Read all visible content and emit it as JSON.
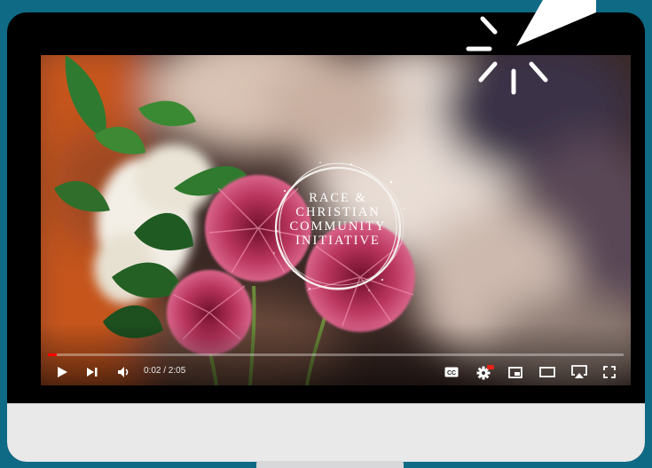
{
  "video": {
    "title_line1": "RACE &",
    "title_line2": "CHRISTIAN",
    "title_line3": "COMMUNITY",
    "title_line4": "INITIATIVE",
    "current_time": "0:02",
    "duration": "2:05",
    "time_display": "0:02 / 2:05",
    "progress_fraction": 0.016
  },
  "controls": {
    "play_icon": "play-icon",
    "next_icon": "next-icon",
    "volume_icon": "volume-icon",
    "captions_icon": "captions-icon",
    "settings_icon": "settings-icon",
    "miniplayer_icon": "miniplayer-icon",
    "theater_icon": "theater-icon",
    "airplay_icon": "airplay-icon",
    "fullscreen_icon": "fullscreen-icon",
    "progress_color": "#ff0000",
    "settings_badge_color": "#e62117"
  },
  "colors": {
    "background": "#0f6a86",
    "bezel": "#000000",
    "chin": "#e9e9ea"
  }
}
